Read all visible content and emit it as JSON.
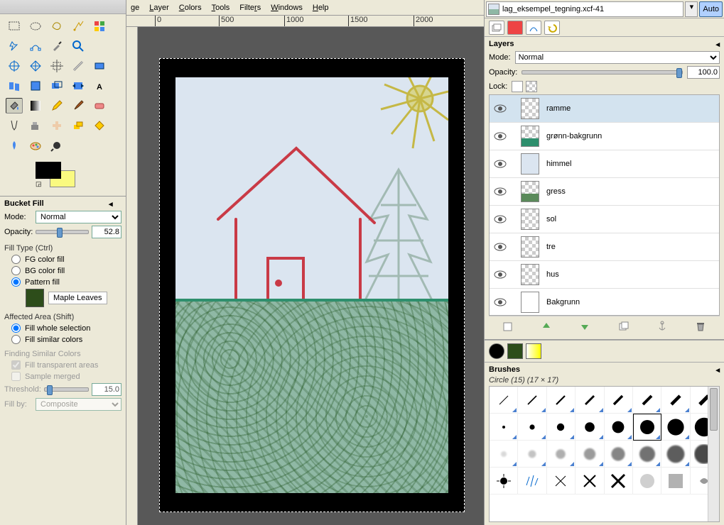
{
  "menubar": {
    "image": "ge",
    "layer": "Layer",
    "colors": "Colors",
    "tools": "Tools",
    "filters": "Filters",
    "windows": "Windows",
    "help": "Help"
  },
  "ruler": {
    "t0": "0",
    "t1": "500",
    "t2": "1000",
    "t3": "1500",
    "t4": "2000"
  },
  "tool_options": {
    "title": "Bucket Fill",
    "mode_label": "Mode:",
    "mode_value": "Normal",
    "opacity_label": "Opacity:",
    "opacity_value": "52.8",
    "fill_type_label": "Fill Type  (Ctrl)",
    "fg": "FG color fill",
    "bg": "BG color fill",
    "pattern": "Pattern fill",
    "pattern_name": "Maple Leaves",
    "affected_label": "Affected Area  (Shift)",
    "fill_whole": "Fill whole selection",
    "fill_similar": "Fill similar colors",
    "finding_label": "Finding Similar Colors",
    "transparent": "Fill transparent areas",
    "sample_merged": "Sample merged",
    "threshold_label": "Threshold:",
    "threshold_value": "15.0",
    "fillby_label": "Fill by:",
    "fillby_value": "Composite"
  },
  "dock": {
    "image_name": "lag_eksempel_tegning.xcf-41",
    "auto": "Auto"
  },
  "layers": {
    "title": "Layers",
    "mode_label": "Mode:",
    "mode_value": "Normal",
    "opacity_label": "Opacity:",
    "opacity_value": "100.0",
    "lock_label": "Lock:",
    "items": [
      {
        "name": "ramme",
        "thumb": "checker"
      },
      {
        "name": "grønn-bakgrunn",
        "thumb": "green"
      },
      {
        "name": "himmel",
        "thumb": "sky"
      },
      {
        "name": "gress",
        "thumb": "grassy"
      },
      {
        "name": "sol",
        "thumb": "checker"
      },
      {
        "name": "tre",
        "thumb": "checker"
      },
      {
        "name": "hus",
        "thumb": "checker"
      },
      {
        "name": "Bakgrunn",
        "thumb": "white"
      }
    ],
    "selected": 0
  },
  "brushes": {
    "title": "Brushes",
    "info": "Circle (15) (17 × 17)"
  }
}
